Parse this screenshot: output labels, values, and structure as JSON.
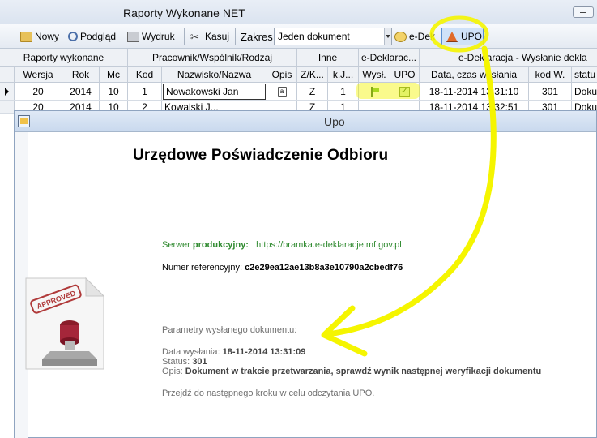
{
  "app": {
    "title": "Raporty Wykonane NET"
  },
  "toolbar": {
    "nowy": "Nowy",
    "podglad": "Podgląd",
    "wydruk": "Wydruk",
    "kasuj": "Kasuj",
    "zakres_label": "Zakres",
    "zakres_value": "Jeden dokument",
    "edek": "e-Dek",
    "upo": "UPO"
  },
  "grid": {
    "group_headers": [
      "Raporty wykonane",
      "Pracownik/Wspólnik/Rodzaj",
      "Inne",
      "e-Deklarac...",
      "e-Deklaracja - Wysłanie dekla"
    ],
    "columns": [
      "Wersja",
      "Rok",
      "Mc",
      "Kod",
      "Nazwisko/Nazwa",
      "Opis",
      "Z/K...",
      "k.J...",
      "Wysł.",
      "UPO",
      "Data, czas wysłania",
      "kod W.",
      "statu"
    ],
    "rows": [
      {
        "wersja": "20",
        "rok": "2014",
        "mc": "10",
        "kod": "1",
        "nazwisko": "Nowakowski Jan",
        "zk": "Z",
        "kj": "1",
        "data": "18-11-2014 13:31:10",
        "kodw": "301",
        "status": "Doku"
      },
      {
        "wersja": "20",
        "rok": "2014",
        "mc": "10",
        "kod": "2",
        "nazwisko": "Kowalski J...",
        "zk": "Z",
        "kj": "1",
        "data": "18-11-2014 13:32:51",
        "kodw": "301",
        "status": "Doku"
      }
    ]
  },
  "dialog": {
    "title": "Upo",
    "heading": "Urzędowe Poświadczenie Odbioru",
    "server_label": "Serwer",
    "server_type": "produkcyjny:",
    "server_url": "https://bramka.e-deklaracje.mf.gov.pl",
    "ref_label": "Numer referencyjny:",
    "ref_value": "c2e29ea12ae13b8a3e10790a2cbedf76",
    "params_label": "Parametry wysłanego dokumentu:",
    "date_label": "Data wysłania:",
    "date_value": "18-11-2014 13:31:09",
    "status_label": "Status:",
    "status_value": "301",
    "opis_label": "Opis:",
    "opis_value": "Dokument w trakcie przetwarzania, sprawdź wynik następnej weryfikacji dokumentu",
    "next_step": "Przejdź do następnego kroku w celu odczytania UPO.",
    "stamp_text": "APPROVED"
  },
  "colors": {
    "highlight": "#f5f500",
    "accent_green": "#2f8a2f",
    "dialog_border": "#8fa4c0"
  },
  "icons": [
    "folder-icon",
    "preview-icon",
    "print-icon",
    "scissors-icon",
    "edek-icon",
    "upo-icon",
    "flag-icon",
    "check-icon",
    "approved-stamp-icon"
  ]
}
